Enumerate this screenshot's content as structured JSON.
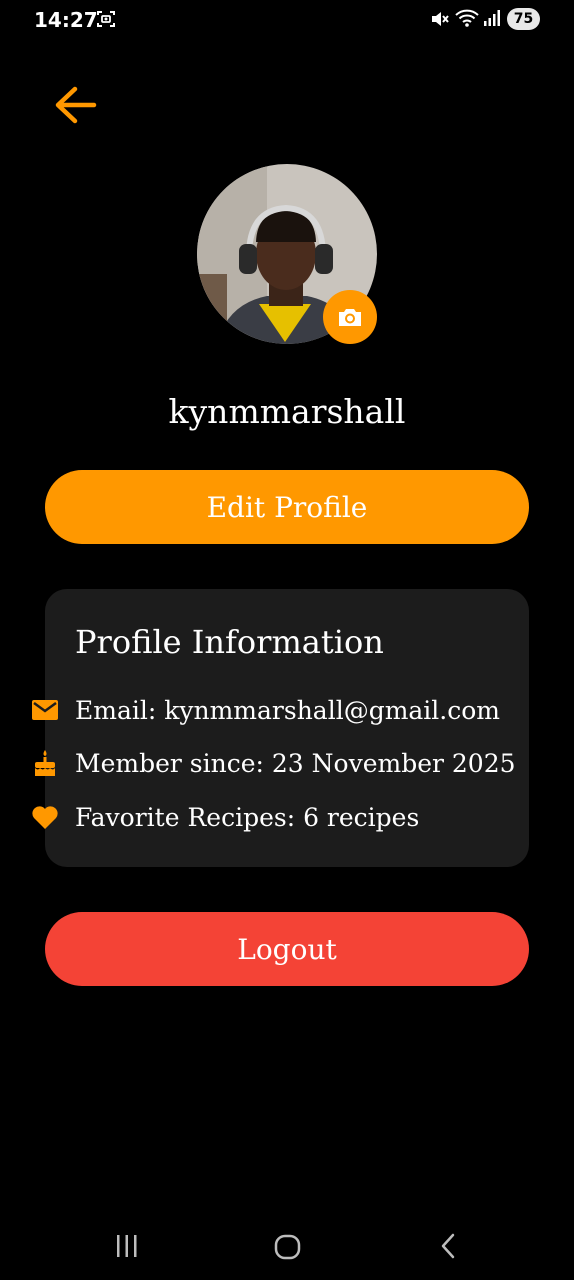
{
  "status_bar": {
    "time": "14:27",
    "battery": "75",
    "icons": [
      "screenshot-icon",
      "mute-icon",
      "wifi-icon",
      "signal-icon"
    ]
  },
  "profile": {
    "username": "kynmmarshall",
    "avatar": "user-photo"
  },
  "actions": {
    "edit_label": "Edit Profile",
    "logout_label": "Logout"
  },
  "info": {
    "title": "Profile Information",
    "rows": [
      {
        "icon": "mail-icon",
        "text": "Email: kynmmarshall@gmail.com"
      },
      {
        "icon": "cake-icon",
        "text": "Member since: 23 November 2025"
      },
      {
        "icon": "heart-icon",
        "text": "Favorite Recipes: 6 recipes"
      }
    ]
  },
  "nav": {
    "icons": [
      "recents-icon",
      "home-icon",
      "back-nav-icon"
    ]
  },
  "colors": {
    "accent": "#ff9800",
    "danger": "#f44336",
    "card": "#1c1c1c",
    "background": "#000000"
  }
}
